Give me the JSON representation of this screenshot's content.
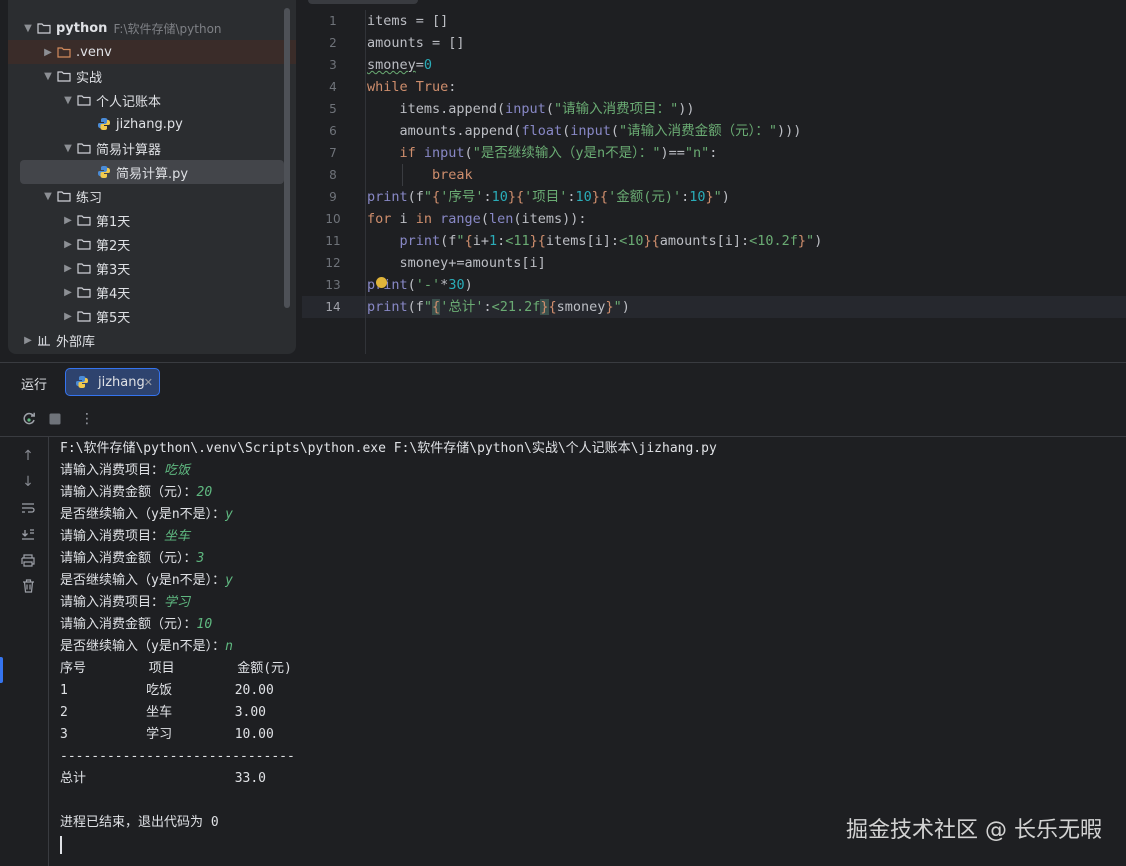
{
  "project_tree": {
    "root": {
      "label": "python",
      "path": "F:\\软件存储\\python"
    },
    "items": [
      {
        "label": ".venv"
      },
      {
        "label": "实战"
      },
      {
        "label": "个人记账本"
      },
      {
        "label": "jizhang.py"
      },
      {
        "label": "简易计算器"
      },
      {
        "label": "简易计算.py"
      },
      {
        "label": "练习"
      },
      {
        "label": "第1天"
      },
      {
        "label": "第2天"
      },
      {
        "label": "第3天"
      },
      {
        "label": "第4天"
      },
      {
        "label": "第5天"
      },
      {
        "label": "外部库"
      }
    ]
  },
  "editor": {
    "line_numbers": [
      "1",
      "2",
      "3",
      "4",
      "5",
      "6",
      "7",
      "8",
      "9",
      "10",
      "11",
      "12",
      "13",
      "14"
    ],
    "current_line": "14"
  },
  "run_window": {
    "title": "运行",
    "tab_label": "jizhang"
  },
  "console": {
    "lines": [
      {
        "prompt": "F:\\软件存储\\python\\.venv\\Scripts\\python.exe F:\\软件存储\\python\\实战\\个人记账本\\jizhang.py",
        "input": ""
      },
      {
        "prompt": "请输入消费项目：",
        "input": "吃饭"
      },
      {
        "prompt": "请输入消费金额（元）：",
        "input": "20"
      },
      {
        "prompt": "是否继续输入（y是n不是）：",
        "input": "y"
      },
      {
        "prompt": "请输入消费项目：",
        "input": "坐车"
      },
      {
        "prompt": "请输入消费金额（元）：",
        "input": "3"
      },
      {
        "prompt": "是否继续输入（y是n不是）：",
        "input": "y"
      },
      {
        "prompt": "请输入消费项目：",
        "input": "学习"
      },
      {
        "prompt": "请输入消费金额（元）：",
        "input": "10"
      },
      {
        "prompt": "是否继续输入（y是n不是）：",
        "input": "n"
      },
      {
        "prompt": "序号        项目        金额(元)",
        "input": ""
      },
      {
        "prompt": "1          吃饭        20.00",
        "input": ""
      },
      {
        "prompt": "2          坐车        3.00",
        "input": ""
      },
      {
        "prompt": "3          学习        10.00",
        "input": ""
      },
      {
        "prompt": "------------------------------",
        "input": ""
      },
      {
        "prompt": "总计                   33.0",
        "input": ""
      },
      {
        "prompt": "",
        "input": ""
      },
      {
        "prompt": "进程已结束，退出代码为 0",
        "input": ""
      }
    ]
  },
  "watermark": "掘金技术社区 @ 长乐无暇",
  "colors": {
    "background": "#1e1f22",
    "panel": "#2b2d30",
    "accent": "#3574f0",
    "keyword": "#cf8e6d",
    "string": "#6aab73",
    "number": "#2aacb8",
    "function": "#56a8f5",
    "console_input": "#5fb880"
  }
}
